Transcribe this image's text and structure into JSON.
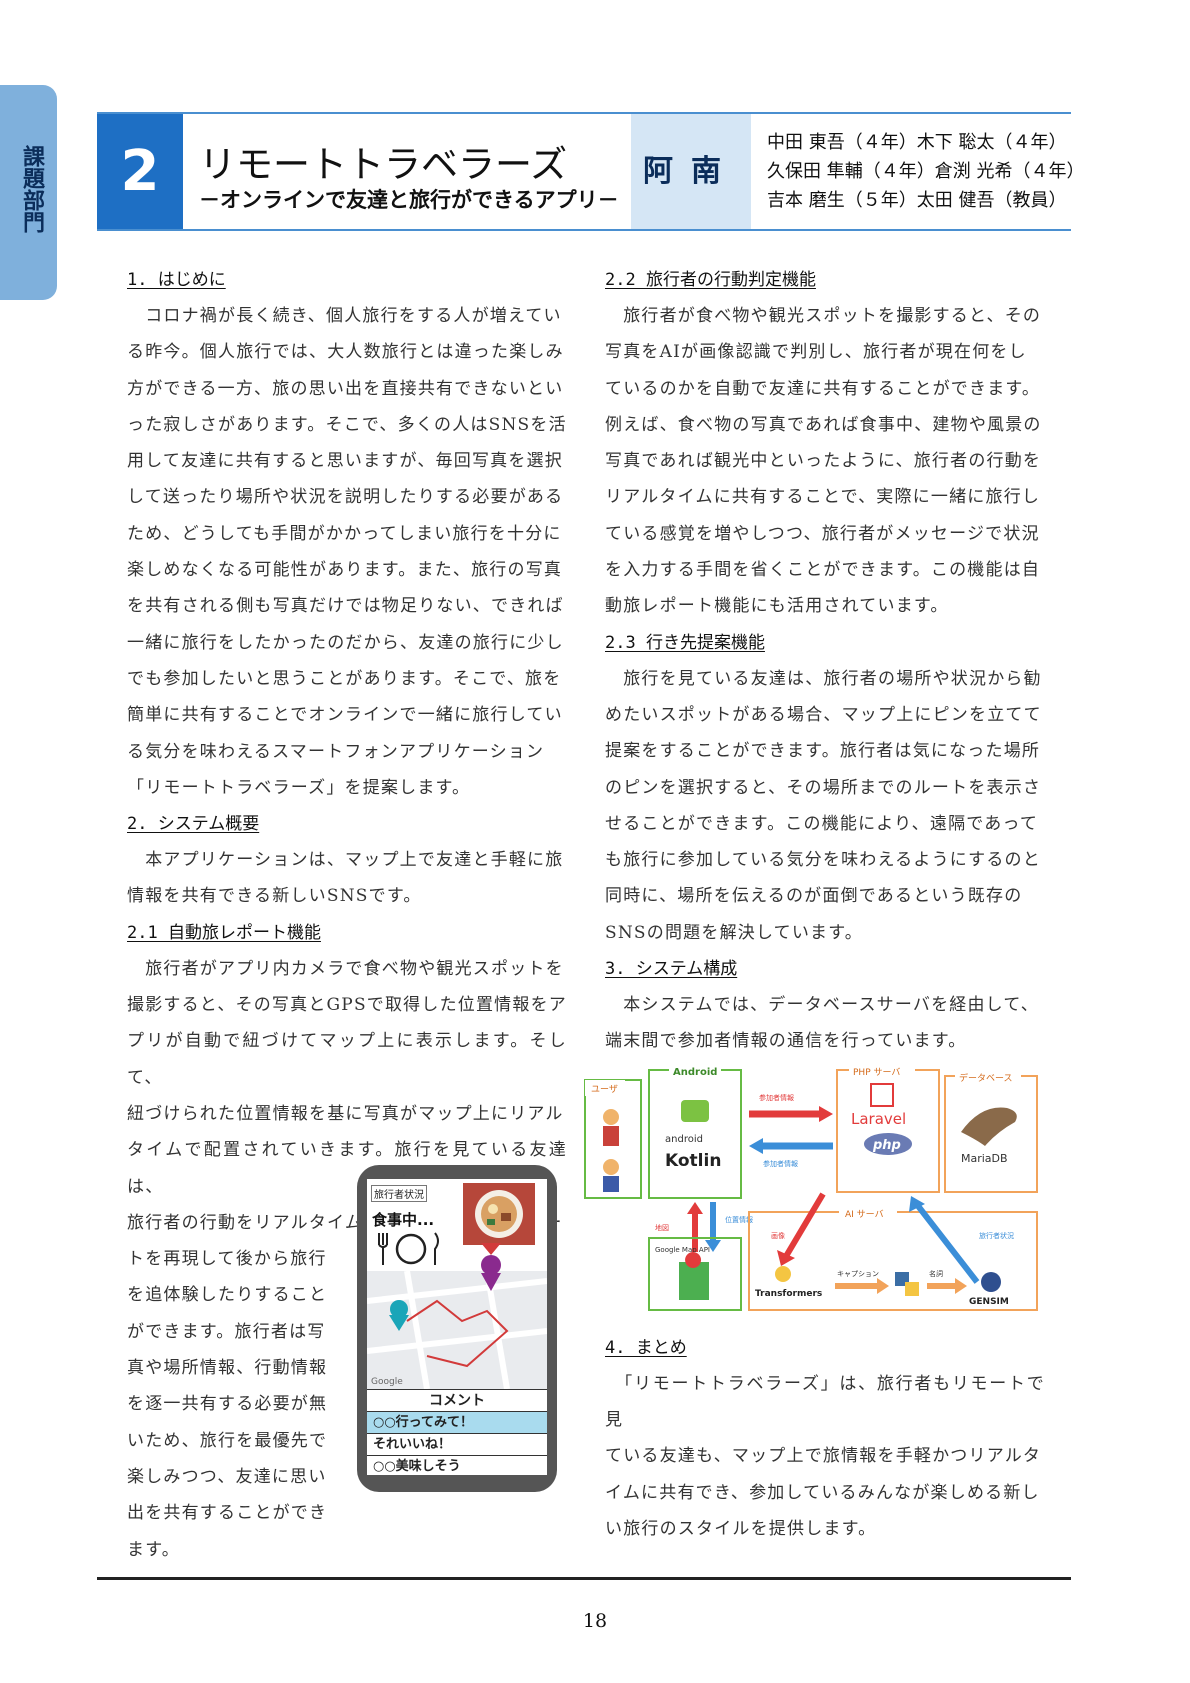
{
  "side_tab": {
    "label": "課題部門"
  },
  "header": {
    "number": "2",
    "title": "リモートトラベラーズ",
    "subtitle": "－オンラインで友達と旅行ができるアプリ－",
    "school": "阿南",
    "members": [
      "中田 東吾（４年）木下 聡太（４年）",
      "久保田 隼輔（４年）倉渕 光希（４年）",
      "吉本 磨生（５年）太田 健吾（教員）"
    ]
  },
  "left_column": {
    "s1_heading": "1. はじめに",
    "s1_lines": [
      "　コロナ禍が長く続き、個人旅行をする人が増えてい",
      "る昨今。個人旅行では、大人数旅行とは違った楽しみ",
      "方ができる一方、旅の思い出を直接共有できないとい",
      "った寂しさがあります。そこで、多くの人はSNSを活",
      "用して友達に共有すると思いますが、毎回写真を選択",
      "して送ったり場所や状況を説明したりする必要がある",
      "ため、どうしても手間がかかってしまい旅行を十分に",
      "楽しめなくなる可能性があります。また、旅行の写真",
      "を共有される側も写真だけでは物足りない、できれば",
      "一緒に旅行をしたかったのだから、友達の旅行に少し",
      "でも参加したいと思うことがあります。そこで、旅を",
      "簡単に共有することでオンラインで一緒に旅行してい",
      "る気分を味わえるスマートフォンアプリケーション",
      "「リモートトラベラーズ」を提案します。"
    ],
    "s2_heading": "2. システム概要",
    "s2_lines": [
      "　本アプリケーションは、マップ上で友達と手軽に旅",
      "情報を共有できる新しいSNSです。"
    ],
    "s21_heading": "2.1 自動旅レポート機能",
    "s21_lines": [
      "　旅行者がアプリ内カメラで食べ物や観光スポットを",
      "撮影すると、その写真とGPSで取得した位置情報をア",
      "プリが自動で紐づけてマップ上に表示します。そして、",
      "紐づけられた位置情報を基に写真がマップ上にリアル",
      "タイムで配置されていきます。旅行を見ている友達は、",
      "旅行者の行動をリアルタイムで追ったり、通ったルー"
    ],
    "s21_narrow_lines": [
      "トを再現して後から旅行",
      "を追体験したりすること",
      "ができます。旅行者は写",
      "真や場所情報、行動情報",
      "を逐一共有する必要が無",
      "いため、旅行を最優先で",
      "楽しみつつ、友達に思い",
      "出を共有することができ",
      "ます。"
    ]
  },
  "phone": {
    "status_label": "旅行者状況",
    "eating_label": "食事中...",
    "google_label": "Google",
    "comment_title": "コメント",
    "comments": [
      "○○行ってみて！",
      "それいいね！",
      "○○美味しそう"
    ]
  },
  "right_column": {
    "s22_heading": "2.2 旅行者の行動判定機能",
    "s22_lines": [
      "　旅行者が食べ物や観光スポットを撮影すると、その",
      "写真をAIが画像認識で判別し、旅行者が現在何をし",
      "ているのかを自動で友達に共有することができます。",
      "例えば、食べ物の写真であれば食事中、建物や風景の",
      "写真であれば観光中といったように、旅行者の行動を",
      "リアルタイムに共有することで、実際に一緒に旅行し",
      "ている感覚を増やしつつ、旅行者がメッセージで状況",
      "を入力する手間を省くことができます。この機能は自",
      "動旅レポート機能にも活用されています。"
    ],
    "s23_heading": "2.3 行き先提案機能",
    "s23_lines": [
      "　旅行を見ている友達は、旅行者の場所や状況から勧",
      "めたいスポットがある場合、マップ上にピンを立てて",
      "提案をすることができます。旅行者は気になった場所",
      "のピンを選択すると、その場所までのルートを表示さ",
      "せることができます。この機能により、遠隔であって",
      "も旅行に参加している気分を味わえるようにするのと",
      "同時に、場所を伝えるのが面倒であるという既存の",
      "SNSの問題を解決しています。"
    ],
    "s3_heading": "3. システム構成",
    "s3_lines": [
      "　本システムでは、データベースサーバを経由して、",
      "端末間で参加者情報の通信を行っています。"
    ],
    "s4_heading": "4. まとめ",
    "s4_lines": [
      "　「リモートトラベラーズ」は、旅行者もリモートで見",
      "ている友達も、マップ上で旅情報を手軽かつリアルタ",
      "イムに共有でき、参加しているみんなが楽しめる新し",
      "い旅行のスタイルを提供します。"
    ]
  },
  "diagram": {
    "user_label": "ユーザ",
    "android_label": "Android",
    "android_word": "android",
    "kotlin_label": "Kotlin",
    "php_server_label": "PHP サーバ",
    "database_label": "データベース",
    "laravel_label": "Laravel",
    "php_label": "php",
    "mariadb_label": "MariaDB",
    "participant_info_1": "参加者情報",
    "participant_info_2": "参加者情報",
    "map_label": "地図",
    "location_label": "位置情報",
    "google_map_api_label": "Google Map API",
    "ai_server_label": "AI サーバ",
    "image_label": "画像",
    "traveler_status_label": "旅行者状況",
    "caption_label": "キャプション",
    "category_label": "名詞",
    "transformers_label": "Transformers",
    "gensim_label": "GENSIM",
    "colors": {
      "green": "#66bb44",
      "orange": "#f2a35a",
      "red": "#e23b3b",
      "blue": "#3b8ed8"
    }
  },
  "footer": {
    "page_number": "18"
  }
}
